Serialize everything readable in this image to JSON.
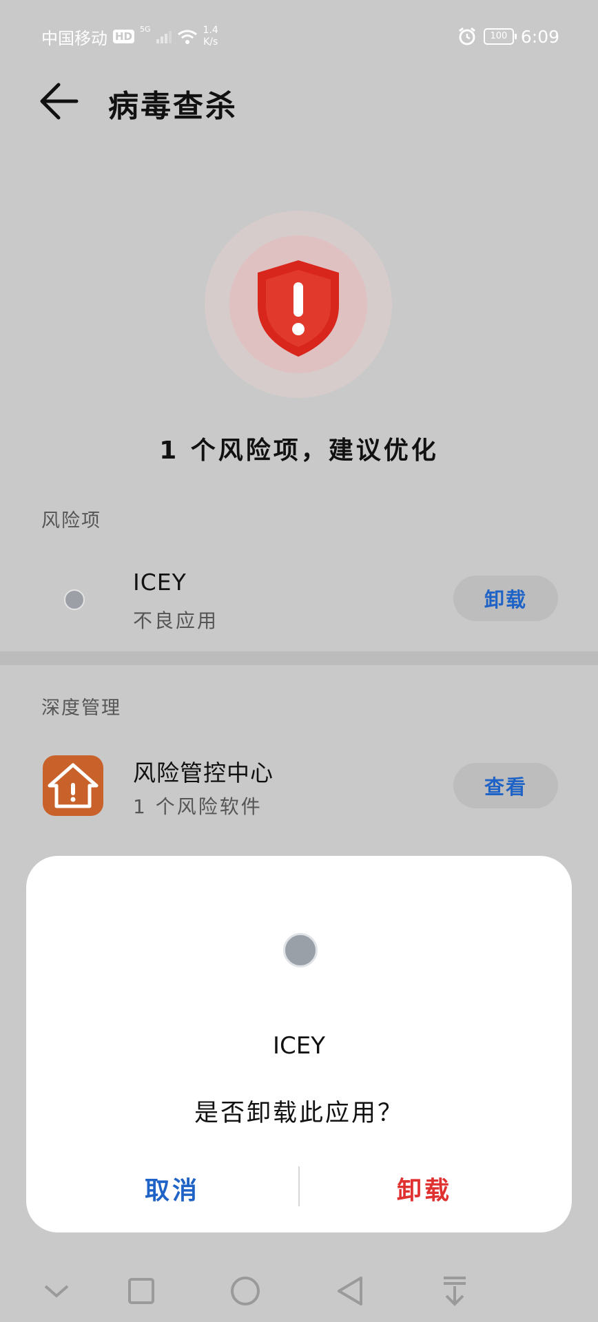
{
  "status_bar": {
    "carrier": "中国移动",
    "hd": "HD",
    "network": "5G",
    "net_speed_value": "1.4",
    "net_speed_unit": "K/s",
    "battery": "100",
    "time": "6:09"
  },
  "header": {
    "title": "病毒查杀",
    "back_icon": "arrow-left-icon"
  },
  "hero": {
    "icon": "warning-shield-icon",
    "summary": "1 个风险项，建议优化",
    "accent_color": "#d8261c"
  },
  "risk_section": {
    "label": "风险项",
    "items": [
      {
        "name": "ICEY",
        "subtitle": "不良应用",
        "action": "卸载"
      }
    ]
  },
  "deep_section": {
    "label": "深度管理",
    "items": [
      {
        "name": "风险管控中心",
        "subtitle": "1 个风险软件",
        "action": "查看",
        "icon": "house-warning-icon",
        "icon_color": "#c9622a"
      }
    ]
  },
  "dialog": {
    "app_name": "ICEY",
    "message": "是否卸载此应用？",
    "cancel": "取消",
    "confirm": "卸载",
    "cancel_color": "#1f63c6",
    "confirm_color": "#e03131"
  },
  "nav_bar": {
    "icons": [
      "chevron-down-icon",
      "square-recents-icon",
      "circle-home-icon",
      "triangle-back-icon",
      "notification-pull-icon"
    ]
  }
}
